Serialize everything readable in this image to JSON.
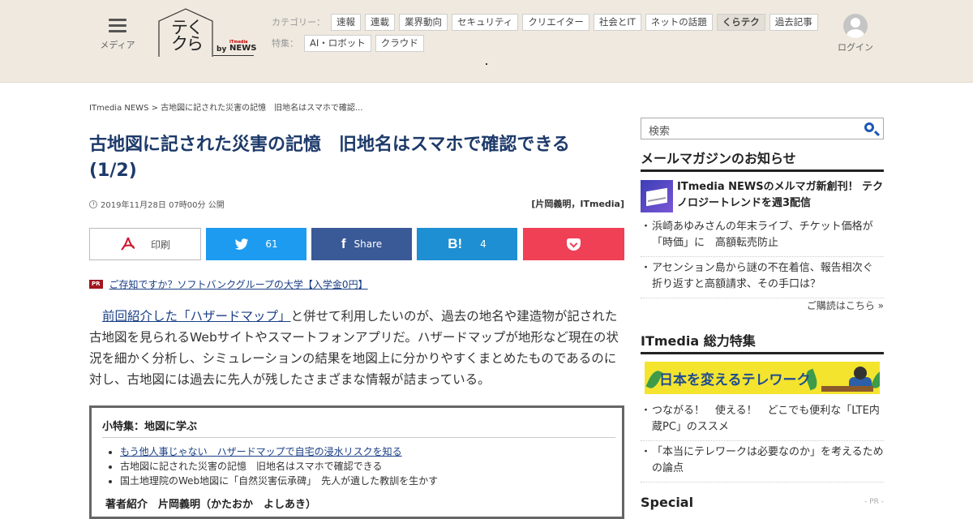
{
  "header": {
    "menu_label": "メディア",
    "logo": {
      "line1": "テく",
      "line2": "クら",
      "by": "by",
      "news_small": "ITmedia",
      "news": "NEWS"
    },
    "category_label": "カテゴリー：",
    "categories": [
      "速報",
      "連載",
      "業界動向",
      "セキュリティ",
      "クリエイター",
      "社会とIT",
      "ネットの話題",
      "くらテク",
      "過去記事"
    ],
    "feature_label": "特集：",
    "features": [
      "AI・ロボット",
      "クラウド"
    ],
    "login_label": "ログイン"
  },
  "breadcrumb": "ITmedia NEWS > 古地図に記された災害の記憶　旧地名はスマホで確認...",
  "article": {
    "title": "古地図に記された災害の記憶　旧地名はスマホで確認できる (1/2)",
    "date": "2019年11月28日 07時00分 公開",
    "author": "[片岡義明，ITmedia]",
    "share": {
      "print": "印刷",
      "twitter_count": "61",
      "facebook": "Share",
      "hatena_count": "4"
    },
    "pr_badge": "PR",
    "pr_link": "ご存知ですか？ソフトバンクグループの大学【入学金0円】",
    "body_link": "前回紹介した「ハザードマップ」",
    "body_text": "と併せて利用したいのが、過去の地名や建造物が記された古地図を見られるWebサイトやスマートフォンアプリだ。ハザードマップが地形など現在の状況を細かく分析し、シミュレーションの結果を地図上に分かりやすくまとめたものであるのに対し、古地図には過去に先人が残したさまざまな情報が詰まっている。",
    "box": {
      "heading": "小特集：地図に学ぶ",
      "items": [
        "もう他人事じゃない　ハザードマップで自宅の浸水リスクを知る",
        "古地図に記された災害の記憶　旧地名はスマホで確認できる",
        "国土地理院のWeb地図に「自然災害伝承碑」　先人が遺した教訓を生かす"
      ],
      "author_heading": "著者紹介　片岡義明（かたおか　よしあき）"
    }
  },
  "sidebar": {
    "search_placeholder": "検索",
    "mail_heading": "メールマガジンのお知らせ",
    "mail_feature": "ITmedia NEWSのメルマガ新創刊！ テクノロジートレンドを週3配信",
    "mail_items": [
      "浜崎あゆみさんの年末ライブ、チケット価格が「時価」に　高額転売防止",
      "アセンション島から謎の不在着信、報告相次ぐ　折り返すと高額請求、その手口は？"
    ],
    "mail_more": "ご購読はこちら »",
    "sokatsu_heading": "ITmedia 総力特集",
    "banner_text": "日本を変えるテレワーク",
    "sokatsu_items": [
      "つながる！　使える！　どこでも便利な「LTE内蔵PC」のススメ",
      "「本当にテレワークは必要なのか」を考えるための論点"
    ],
    "special_heading": "Special",
    "pr_tag": "- PR -"
  }
}
